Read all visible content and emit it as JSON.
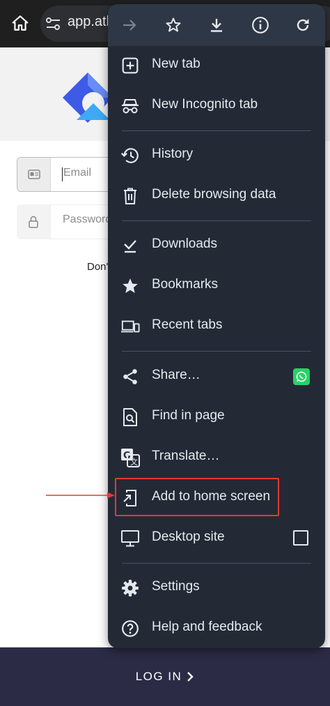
{
  "browser": {
    "url_text": "app.atl"
  },
  "page": {
    "email_placeholder": "Email",
    "password_placeholder": "Password",
    "dont_text": "Don'",
    "login_label": "LOG IN"
  },
  "menu": {
    "toolbar": [
      "forward-icon",
      "star-icon",
      "download-icon",
      "info-icon",
      "refresh-icon"
    ],
    "items": [
      {
        "label": "New tab",
        "icon": "add-box-icon"
      },
      {
        "label": "New Incognito tab",
        "icon": "incognito-icon"
      },
      {
        "label": "History",
        "icon": "history-icon"
      },
      {
        "label": "Delete browsing data",
        "icon": "trash-icon"
      },
      {
        "label": "Downloads",
        "icon": "download-done-icon"
      },
      {
        "label": "Bookmarks",
        "icon": "star-filled-icon"
      },
      {
        "label": "Recent tabs",
        "icon": "devices-icon"
      },
      {
        "label": "Share…",
        "icon": "share-icon"
      },
      {
        "label": "Find in page",
        "icon": "find-in-page-icon"
      },
      {
        "label": "Translate…",
        "icon": "translate-icon"
      },
      {
        "label": "Add to home screen",
        "icon": "add-to-home-icon"
      },
      {
        "label": "Desktop site",
        "icon": "monitor-icon"
      },
      {
        "label": "Settings",
        "icon": "gear-icon"
      },
      {
        "label": "Help and feedback",
        "icon": "help-icon"
      }
    ]
  },
  "colors": {
    "menu_bg": "#232a36",
    "menu_toolbar_bg": "#2e3745",
    "highlight": "#e53935",
    "whatsapp": "#25d366",
    "footer_bg": "#2c2b46"
  }
}
